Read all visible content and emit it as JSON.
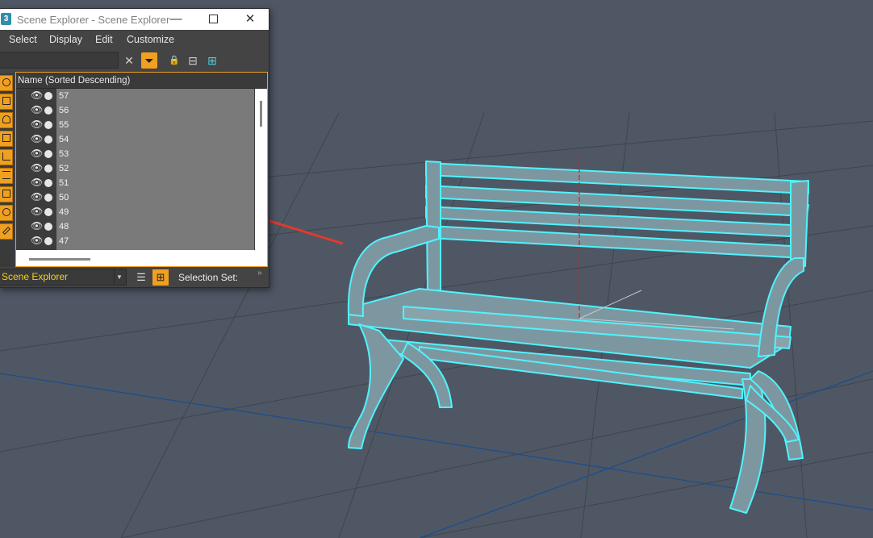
{
  "window": {
    "title": "Scene Explorer - Scene Explorer",
    "app_icon": "3",
    "min_glyph": "—",
    "close_glyph": "✕"
  },
  "menu": {
    "select": "Select",
    "display": "Display",
    "edit": "Edit",
    "customize": "Customize"
  },
  "toolbar": {
    "clear_glyph": "✕",
    "filter_glyph": "⏷",
    "lock_glyph": "🔒",
    "hierarchy_glyph": "⊟",
    "tree_glyph": "⊞"
  },
  "list": {
    "column_header": "Name (Sorted Descending)",
    "rows": [
      "57",
      "56",
      "55",
      "54",
      "53",
      "52",
      "51",
      "50",
      "49",
      "48",
      "47"
    ],
    "eye_glyph": "👁"
  },
  "bottom": {
    "explorer_dropdown": "Scene Explorer",
    "dropdown_arrow": "▼",
    "layers_glyph": "☰",
    "hierarchy_glyph": "⊞",
    "selection_set_label": "Selection Set:",
    "more_glyph": "»"
  },
  "colors": {
    "viewport_bg": "#4f5764",
    "grid_line": "#1d4e8a",
    "bench_fill": "#7d97a0",
    "selection_outline": "#4ff3ff",
    "axis_red": "#d02020",
    "annotation_arrow": "#e23a2e",
    "accent": "#f0a020"
  },
  "icons": {
    "type_filters": [
      "geometry-icon",
      "shape-icon",
      "light-icon",
      "camera-icon",
      "helper-icon",
      "spacewarp-icon",
      "group-icon",
      "xref-icon",
      "bone-icon"
    ]
  }
}
